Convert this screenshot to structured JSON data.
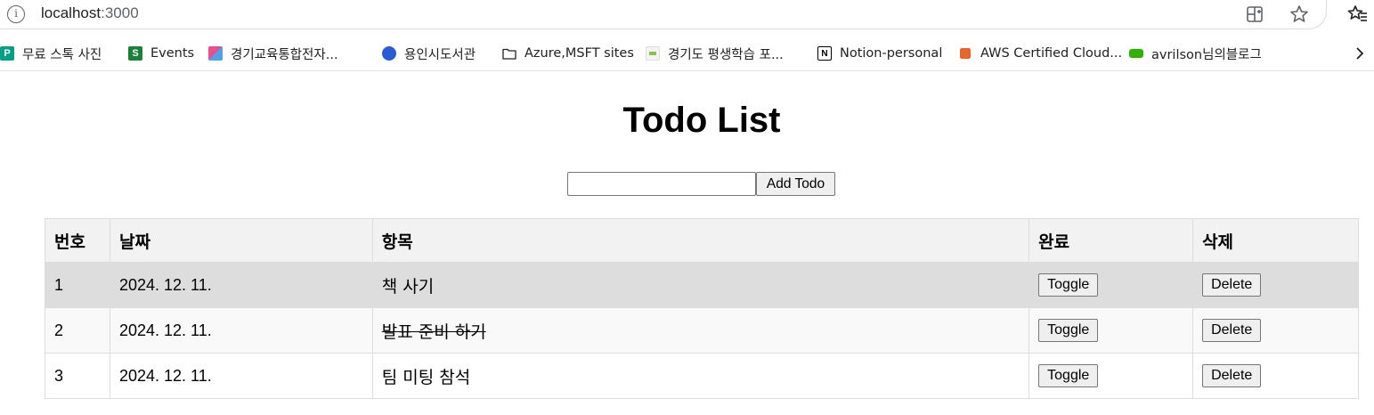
{
  "browser": {
    "url_host": "localhost",
    "url_port": ":3000",
    "bookmarks": [
      {
        "label": "무료 스톡 사진",
        "icon": "photo-stock-icon",
        "color": "#05a081"
      },
      {
        "label": "Events",
        "icon": "sheets-icon",
        "color": "#188038"
      },
      {
        "label": "경기교육통합전자...",
        "icon": "gyeonggi-edu-icon",
        "color": "#e94f8a"
      },
      {
        "label": "용인시도서관",
        "icon": "library-icon",
        "color": "#2a5bd7"
      },
      {
        "label": "Azure,MSFT sites",
        "icon": "folder-icon",
        "color": "#202124"
      },
      {
        "label": "경기도 평생학습 포...",
        "icon": "learning-portal-icon",
        "color": "#8bc34a"
      },
      {
        "label": "Notion-personal",
        "icon": "notion-icon",
        "color": "#000000"
      },
      {
        "label": "AWS Certified Cloud...",
        "icon": "aws-icon",
        "color": "#e8662b"
      },
      {
        "label": "avrilson님의블로그",
        "icon": "blog-icon",
        "color": "#2db400"
      }
    ]
  },
  "app": {
    "title": "Todo List",
    "input_value": "",
    "add_button": "Add Todo",
    "columns": [
      "번호",
      "날짜",
      "항목",
      "완료",
      "삭제"
    ],
    "todos": [
      {
        "num": "1",
        "date": "2024. 12. 11.",
        "text": "책 사기",
        "done": false,
        "toggle": "Toggle",
        "delete": "Delete"
      },
      {
        "num": "2",
        "date": "2024. 12. 11.",
        "text": "발표 준비 하기",
        "done": true,
        "toggle": "Toggle",
        "delete": "Delete"
      },
      {
        "num": "3",
        "date": "2024. 12. 11.",
        "text": "팀 미팅 참석",
        "done": false,
        "toggle": "Toggle",
        "delete": "Delete"
      }
    ]
  }
}
